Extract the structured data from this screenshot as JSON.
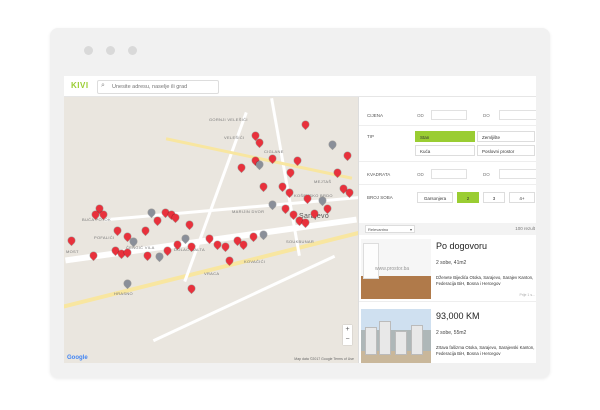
{
  "app": {
    "logo": "KIVI"
  },
  "search": {
    "placeholder": "Unesite adresu, naselje ili grad"
  },
  "map": {
    "labels": [
      "VELEŠIĆI",
      "CIGLANE",
      "MEJTAŠ",
      "KOŠEVSKO BRDO",
      "MARIJIN DVOR",
      "ČENGIĆ VILA",
      "KOVAČIĆI",
      "VRACA",
      "HRASNO",
      "MOST",
      "GORNJI VELEŠIĆI",
      "SOUKBUNAR",
      "POFALIĆI",
      "BUĆA POTOK",
      "DOLAC MALTA",
      "Sarajevo"
    ],
    "zoom_in": "+",
    "zoom_out": "−",
    "google_label": "Google",
    "credit": "Map data ©2017 Google   Terms of Use"
  },
  "filters": {
    "cijena": {
      "label": "CIJENA",
      "od": "OD",
      "do": "DO"
    },
    "tip": {
      "label": "TIP",
      "options": [
        "Stan",
        "Zemljište",
        "Kuća",
        "Poslovni prostor"
      ],
      "active": "Stan"
    },
    "kvadrata": {
      "label": "KVADRATA",
      "od": "OD",
      "do": "DO"
    },
    "broj_soba": {
      "label": "BROJ SOBA",
      "options": [
        "Garsonjera",
        "2",
        "3",
        "4+"
      ],
      "active": "2"
    }
  },
  "sort": {
    "selected": "Relevantno",
    "count": "100 rezult"
  },
  "listings": [
    {
      "price": "Po dogovoru",
      "rooms": "2 sobe, 41m2",
      "address": "Dženete Bijedića Otoka, Sarajevo, Sarajev Kanton, Federacija BiH, Bosna i Hercegov",
      "meta": "Prije 1 s...",
      "watermark": "www.prostor.ba"
    },
    {
      "price": "93,000 KM",
      "rooms": "2 sobe, 55m2",
      "address": "Zrtava fašizma Otoka, Sarajevo, Sarajevski Kanton, Federacija BiH, Bosna i Hercegov"
    }
  ],
  "colors": {
    "accent": "#9acd32",
    "pin_red": "#e8313c",
    "pin_gray": "#8a8f99"
  }
}
